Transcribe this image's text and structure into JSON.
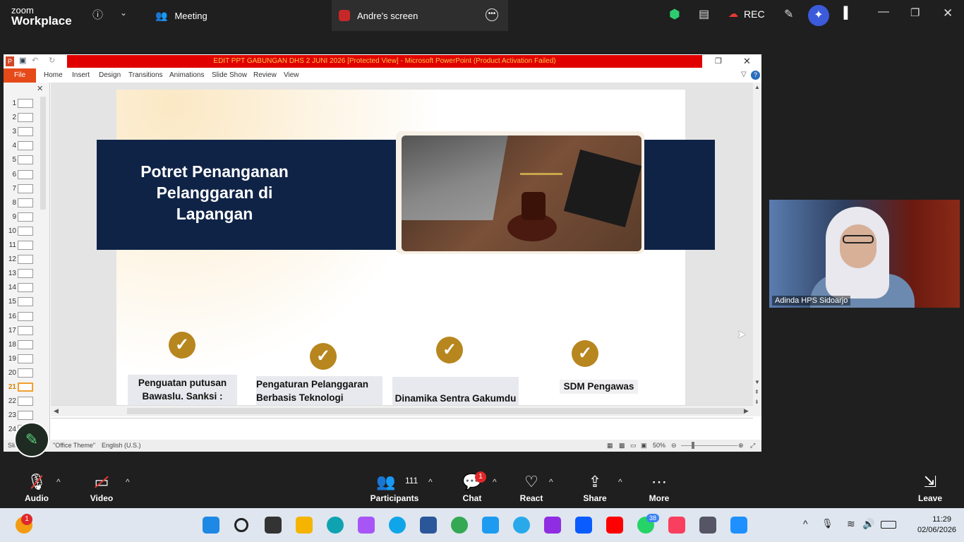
{
  "zoom": {
    "brand_top": "zoom",
    "brand_bottom": "Workplace",
    "tab_meeting": "Meeting",
    "tab_screen": "Andre's screen",
    "rec_label": "REC",
    "toolbar": {
      "audio": "Audio",
      "video": "Video",
      "participants": "Participants",
      "participants_count": "111",
      "chat": "Chat",
      "chat_badge": "1",
      "react": "React",
      "share": "Share",
      "more": "More",
      "leave": "Leave"
    }
  },
  "ppt": {
    "title": "EDIT PPT GABUNGAN DHS 2 JUNI 2026 [Protected View] - Microsoft PowerPoint (Product Activation Failed)",
    "ribbon": [
      "File",
      "Home",
      "Insert",
      "Design",
      "Transitions",
      "Animations",
      "Slide Show",
      "Review",
      "View"
    ],
    "slide_numbers": [
      "1",
      "2",
      "3",
      "4",
      "5",
      "6",
      "7",
      "8",
      "9",
      "10",
      "11",
      "12",
      "13",
      "14",
      "15",
      "16",
      "17",
      "18",
      "19",
      "20",
      "21",
      "22",
      "23",
      "24"
    ],
    "selected_slide": "21",
    "slide": {
      "title": "Potret Penanganan Pelanggaran di Lapangan",
      "points": [
        "Penguatan putusan Bawaslu. Sanksi : Dilaporkan DKPP-peringatan  lisan-tertulis",
        "Pengaturan Pelanggaran Berbasis Teknologi Artificial Intelligence (AI)",
        "Dinamika Sentra Gakumdu",
        "SDM Pengawas"
      ]
    },
    "status": {
      "slide_label": "Slid",
      "theme": "\"Office Theme\"",
      "language": "English (U.S.)",
      "zoom": "50%"
    }
  },
  "video_tile": {
    "name": "Adinda HPS Sidoarjo"
  },
  "taskbar": {
    "time": "11:29",
    "date": "02/06/2026",
    "notification_badge": "1",
    "whatsapp_badge": "38"
  }
}
